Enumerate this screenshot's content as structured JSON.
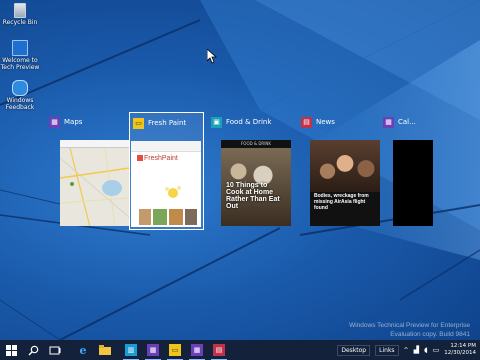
{
  "desktop": {
    "icons": [
      {
        "label": "Recycle Bin"
      },
      {
        "label": "Welcome to Tech Preview"
      },
      {
        "label": "Windows Feedback"
      }
    ]
  },
  "switcher": {
    "tasks": [
      {
        "title": "Maps",
        "icon": "maps-icon",
        "color": "#6b3fb8"
      },
      {
        "title": "Fresh Paint",
        "icon": "fresh-paint-icon",
        "color": "#f0c419",
        "selected": true
      },
      {
        "title": "Food & Drink",
        "icon": "food-drink-icon",
        "color": "#17a2b8"
      },
      {
        "title": "News",
        "icon": "news-icon",
        "color": "#c0324a"
      },
      {
        "title": "Cal...",
        "icon": "calculator-icon",
        "color": "#6b3fb8"
      }
    ],
    "thumbs": {
      "fresh_paint_logo": "FreshPaint",
      "food_header": "FOOD & DRINK",
      "food_headline": "10 Things to Cook at Home Rather Than Eat Out",
      "news_headline": "Bodies, wreckage from missing AirAsia flight found"
    }
  },
  "watermark": {
    "line1": "Windows Technical Preview for Enterprise",
    "line2": "Evaluation copy. Build 9841"
  },
  "taskbar": {
    "desktop_label": "Desktop",
    "links_label": "Links",
    "time": "12:14 PM",
    "date": "12/30/2014"
  }
}
